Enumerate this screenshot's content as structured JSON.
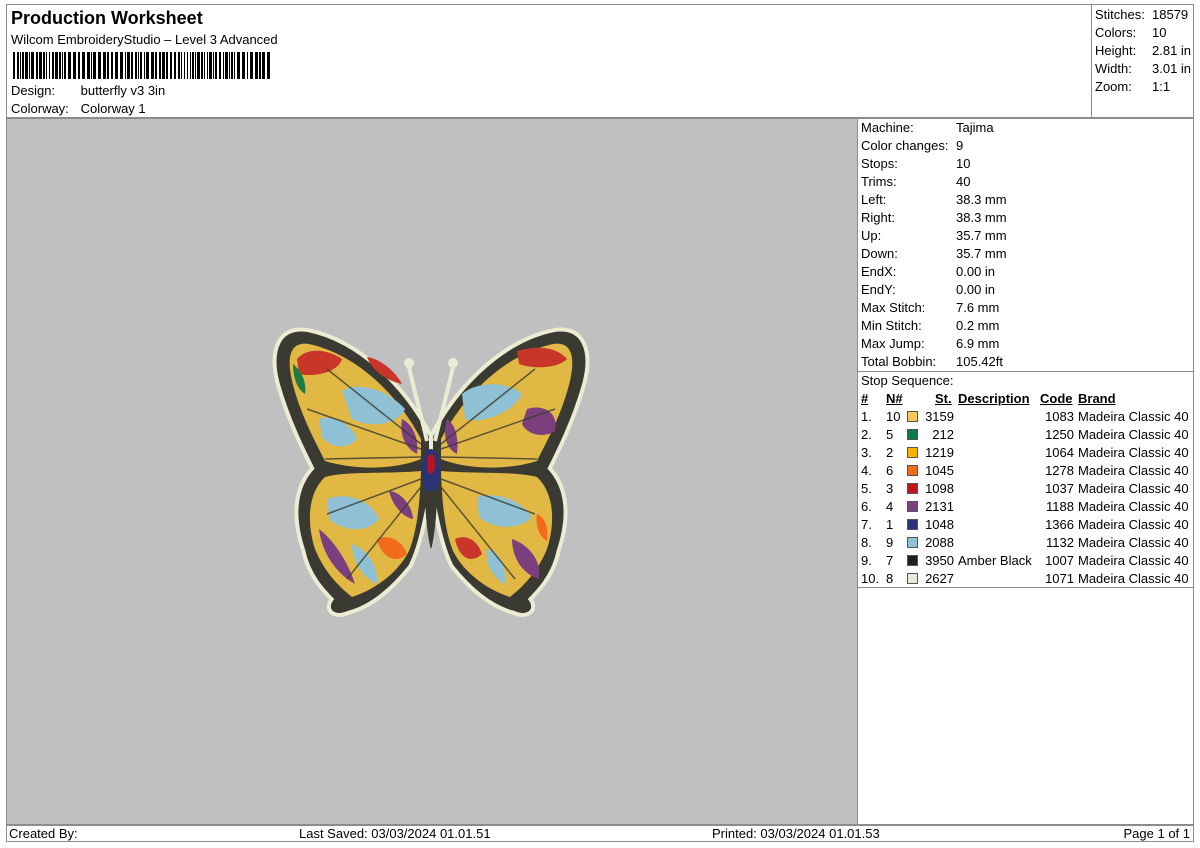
{
  "header": {
    "title": "Production Worksheet",
    "subtitle": "Wilcom EmbroideryStudio – Level 3 Advanced",
    "design_label": "Design:",
    "design_value": "butterfly v3 3in",
    "colorway_label": "Colorway:",
    "colorway_value": "Colorway 1"
  },
  "stats": [
    {
      "label": "Stitches:",
      "value": "18579"
    },
    {
      "label": "Colors:",
      "value": "10"
    },
    {
      "label": "Height:",
      "value": "2.81 in"
    },
    {
      "label": "Width:",
      "value": "3.01 in"
    },
    {
      "label": "Zoom:",
      "value": "1:1"
    }
  ],
  "machine_info": [
    {
      "label": "Machine:",
      "value": "Tajima"
    },
    {
      "label": "Color changes:",
      "value": "9"
    },
    {
      "label": "Stops:",
      "value": "10"
    },
    {
      "label": "Trims:",
      "value": "40"
    },
    {
      "label": "Left:",
      "value": "38.3 mm"
    },
    {
      "label": "Right:",
      "value": "38.3 mm"
    },
    {
      "label": "Up:",
      "value": "35.7 mm"
    },
    {
      "label": "Down:",
      "value": "35.7 mm"
    },
    {
      "label": "EndX:",
      "value": "0.00 in"
    },
    {
      "label": "EndY:",
      "value": "0.00 in"
    },
    {
      "label": "Max Stitch:",
      "value": "7.6 mm"
    },
    {
      "label": "Min Stitch:",
      "value": "0.2 mm"
    },
    {
      "label": "Max Jump:",
      "value": "6.9 mm"
    },
    {
      "label": "Total Bobbin:",
      "value": "105.42ft"
    }
  ],
  "stop_sequence": {
    "title": "Stop Sequence:",
    "columns": {
      "idx": "#",
      "n": "N#",
      "st": "St.",
      "desc": "Description",
      "code": "Code",
      "brand": "Brand"
    },
    "rows": [
      {
        "idx": "1.",
        "n": "10",
        "color": "#f6c75a",
        "st": "3159",
        "desc": "",
        "code": "1083",
        "brand": "Madeira Classic 40"
      },
      {
        "idx": "2.",
        "n": "5",
        "color": "#0b7a4a",
        "st": "212",
        "desc": "",
        "code": "1250",
        "brand": "Madeira Classic 40"
      },
      {
        "idx": "3.",
        "n": "2",
        "color": "#f5b300",
        "st": "1219",
        "desc": "",
        "code": "1064",
        "brand": "Madeira Classic 40"
      },
      {
        "idx": "4.",
        "n": "6",
        "color": "#f26b1d",
        "st": "1045",
        "desc": "",
        "code": "1278",
        "brand": "Madeira Classic 40"
      },
      {
        "idx": "5.",
        "n": "3",
        "color": "#c0141c",
        "st": "1098",
        "desc": "",
        "code": "1037",
        "brand": "Madeira Classic 40"
      },
      {
        "idx": "6.",
        "n": "4",
        "color": "#7c3f7e",
        "st": "2131",
        "desc": "",
        "code": "1188",
        "brand": "Madeira Classic 40"
      },
      {
        "idx": "7.",
        "n": "1",
        "color": "#2a3278",
        "st": "1048",
        "desc": "",
        "code": "1366",
        "brand": "Madeira Classic 40"
      },
      {
        "idx": "8.",
        "n": "9",
        "color": "#8fc0d4",
        "st": "2088",
        "desc": "",
        "code": "1132",
        "brand": "Madeira Classic 40"
      },
      {
        "idx": "9.",
        "n": "7",
        "color": "#1e1e1e",
        "st": "3950",
        "desc": "Amber Black",
        "code": "1007",
        "brand": "Madeira Classic 40"
      },
      {
        "idx": "10.",
        "n": "8",
        "color": "#e9e8da",
        "st": "2627",
        "desc": "",
        "code": "1071",
        "brand": "Madeira Classic 40"
      }
    ]
  },
  "footer": {
    "created_by": "Created By:",
    "last_saved": "Last Saved: 03/03/2024 01.01.51",
    "printed": "Printed: 03/03/2024 01.01.53",
    "page": "Page 1 of 1"
  },
  "colors": {
    "preview_bg": "#c0c0c0",
    "border": "#8c8c8c"
  }
}
